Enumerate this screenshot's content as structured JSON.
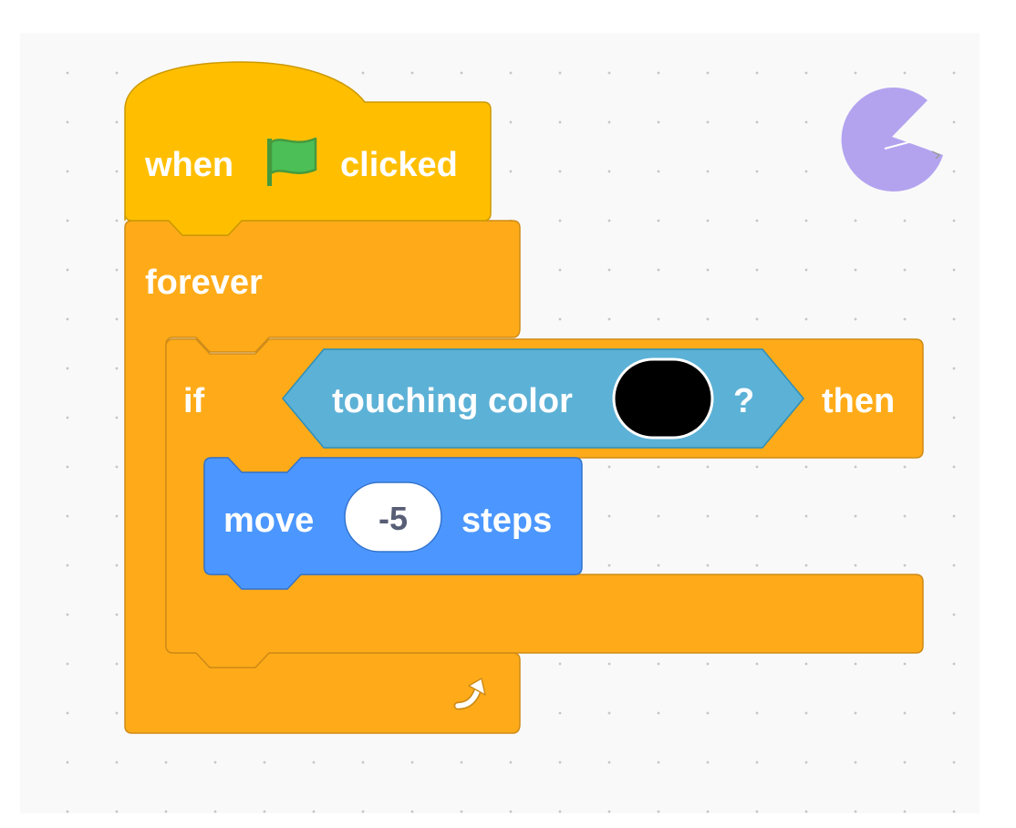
{
  "script": {
    "hat_block": {
      "label_before": "when",
      "label_after": "clicked",
      "icon": "green-flag-icon",
      "color": "#ffbf00"
    },
    "forever_block": {
      "label": "forever",
      "icon": "loop-arrow-icon",
      "color": "#ffab19"
    },
    "if_block": {
      "label_if": "if",
      "label_then": "then",
      "color": "#ffab19"
    },
    "condition_block": {
      "label": "touching color",
      "question": "?",
      "color_value": "#000000",
      "color": "#5cb1d6"
    },
    "move_block": {
      "label_before": "move",
      "value": "-5",
      "label_after": "steps",
      "color": "#4c97ff"
    }
  },
  "workspace": {
    "sprite_icon": "sprite-costume-icon",
    "sprite_color": "#b3a3ef"
  }
}
